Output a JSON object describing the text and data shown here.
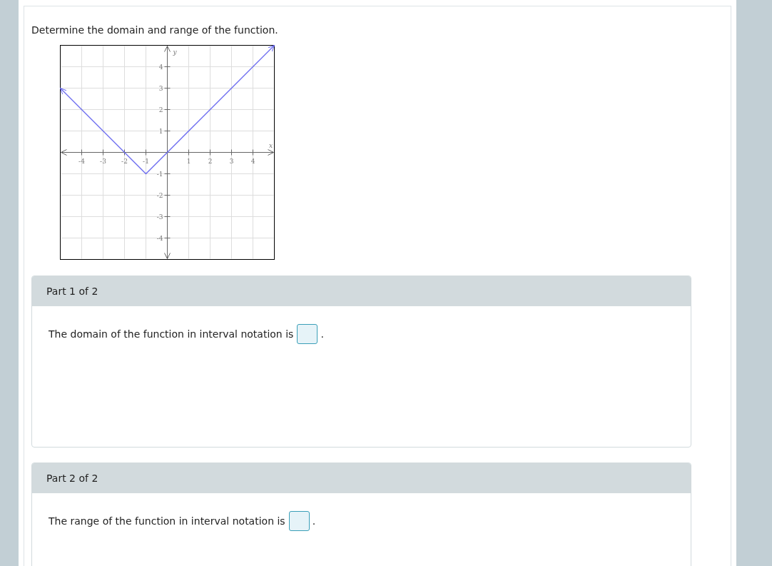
{
  "question": "Determine the domain and range of the function.",
  "graph": {
    "chart_data": {
      "type": "line",
      "grid": true,
      "xlabel": "x",
      "ylabel": "y",
      "x": [
        -5,
        -1,
        5
      ],
      "series": [
        {
          "color": "#6b6bf0",
          "values": [
            3,
            -1,
            5
          ]
        }
      ],
      "xlim": [
        -5,
        5
      ],
      "ylim": [
        -5,
        5
      ],
      "xticks": [
        -4,
        -3,
        -2,
        -1,
        1,
        2,
        3,
        4
      ],
      "yticks": [
        -4,
        -3,
        -2,
        -1,
        1,
        2,
        3,
        4
      ]
    }
  },
  "parts": [
    {
      "title": "Part 1 of 2",
      "text": "The domain of the function in interval notation is",
      "after": "."
    },
    {
      "title": "Part 2 of 2",
      "text": "The range of the function in interval notation is",
      "after": "."
    }
  ]
}
